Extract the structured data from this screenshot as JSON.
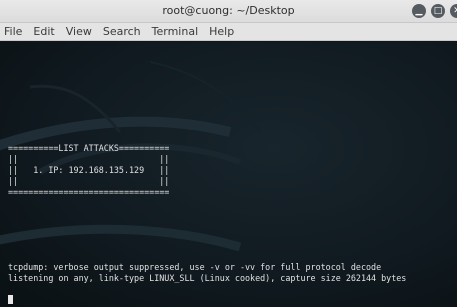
{
  "window": {
    "title": "root@cuong: ~/Desktop"
  },
  "menu": [
    "File",
    "Edit",
    "View",
    "Search",
    "Terminal",
    "Help"
  ],
  "terminal": {
    "banner_lines": [
      "==========LIST ATTACKS==========",
      "||                            ||",
      "||   1. IP: 192.168.135.129   ||",
      "||                            ||",
      "================================"
    ],
    "output_lines": [
      "tcpdump: verbose output suppressed, use -v or -vv for full protocol decode",
      "listening on any, link-type LINUX_SLL (Linux cooked), capture size 262144 bytes"
    ]
  }
}
